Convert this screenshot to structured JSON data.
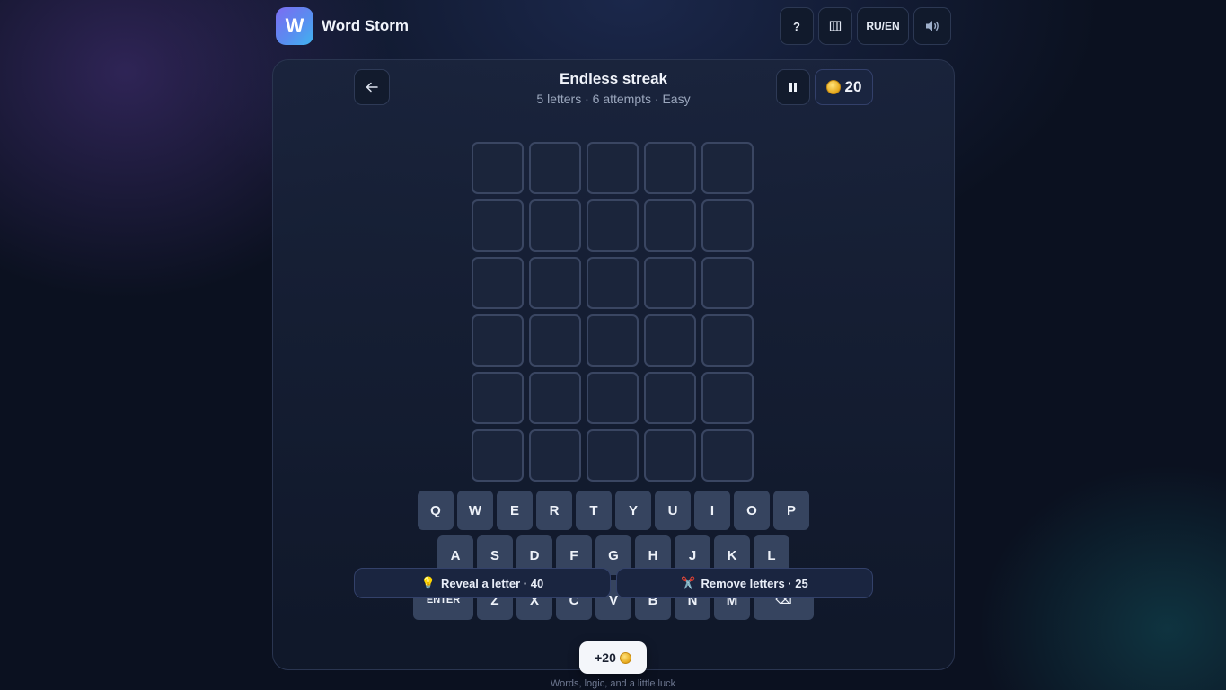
{
  "app": {
    "logo_letter": "W",
    "name": "Word Storm"
  },
  "header_actions": {
    "help_label": "?",
    "stats_icon": "stats-icon",
    "lang_label": "RU/EN",
    "sound_icon": "speaker-icon"
  },
  "game": {
    "title": "Endless streak",
    "subtitle": "5 letters · 6 attempts · Easy",
    "coins": "20",
    "rows": 6,
    "cols": 5
  },
  "keyboard": {
    "row1": [
      "Q",
      "W",
      "E",
      "R",
      "T",
      "Y",
      "U",
      "I",
      "O",
      "P"
    ],
    "row2": [
      "A",
      "S",
      "D",
      "F",
      "G",
      "H",
      "J",
      "K",
      "L"
    ],
    "row3": [
      "ENTER",
      "Z",
      "X",
      "C",
      "V",
      "B",
      "N",
      "M",
      "⌫"
    ]
  },
  "hints": {
    "reveal": {
      "icon": "💡",
      "label": "Reveal a letter · 40"
    },
    "remove": {
      "icon": "✂️",
      "label": "Remove letters · 25"
    }
  },
  "toast": {
    "label": "+20"
  },
  "footer": {
    "tagline": "Words, logic, and a little luck"
  },
  "colors": {
    "accent": "#5a8cf0",
    "tile_border": "#3a4662",
    "key_bg": "#36445f",
    "coin": "#e6a91c"
  }
}
